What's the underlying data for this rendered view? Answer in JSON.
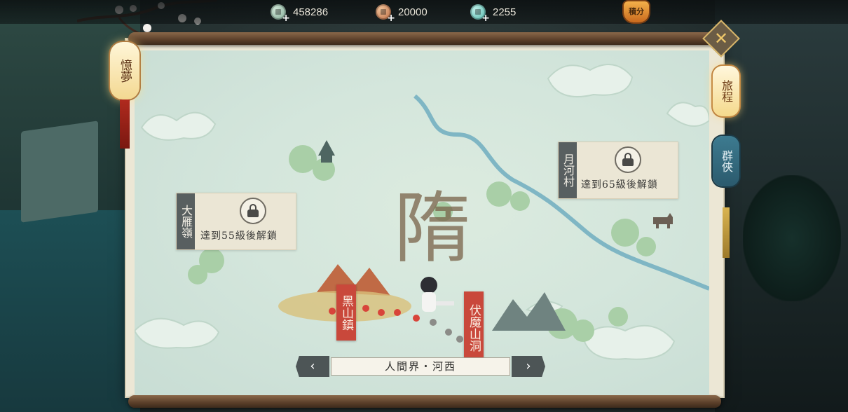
{
  "currencies": [
    {
      "icon": "jade-coin-icon",
      "value": "458286"
    },
    {
      "icon": "copper-coin-icon",
      "value": "20000"
    },
    {
      "icon": "gem-icon",
      "value": "2255"
    }
  ],
  "points_button": "積分",
  "side_lantern": "憶夢",
  "tabs": {
    "journey": "旅程",
    "heroes": "群俠"
  },
  "map": {
    "region_name": "隋",
    "locked_areas": [
      {
        "name": "大雁嶺",
        "requirement": "達到55級後解鎖"
      },
      {
        "name": "月河村",
        "requirement": "達到65級後解鎖"
      }
    ],
    "towns": [
      {
        "name": "黑山鎮"
      },
      {
        "name": "伏魔山洞"
      }
    ]
  },
  "nav": {
    "location": "人間界・河西",
    "prev": "‹",
    "next": "›"
  },
  "close_label": "✕",
  "colors": {
    "map_bg": "#d4e6dc",
    "river": "#7fb6c4",
    "town_tag": "#c9483b",
    "lock_tag": "#585f60",
    "active_tab": "#f5d98c",
    "inactive_tab": "#2b5a6d"
  }
}
